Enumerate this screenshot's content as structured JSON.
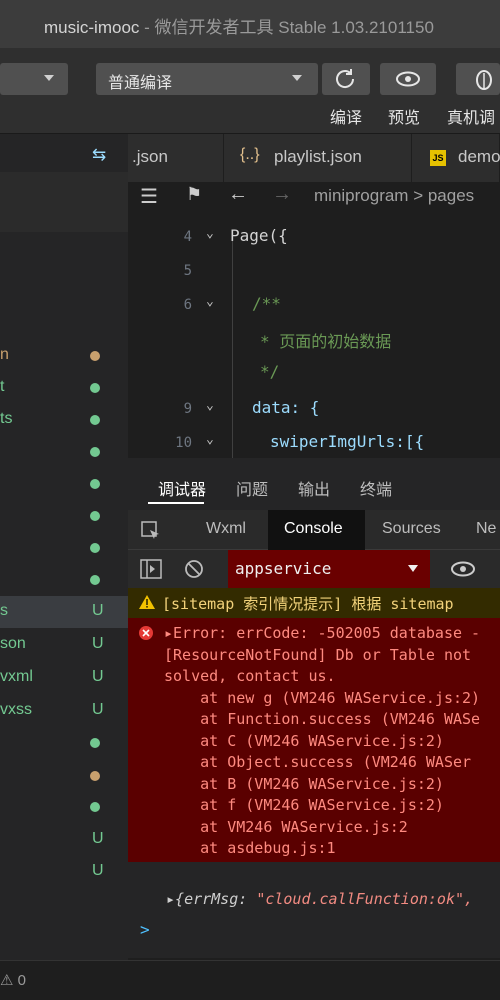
{
  "window": {
    "title_main": "music-imooc",
    "title_sub": " - 微信开发者工具 Stable 1.03.2101150"
  },
  "toolbar": {
    "compile_mode": "普通编译",
    "compile_label": "编译",
    "preview_label": "预览",
    "realdebug_label": "真机调"
  },
  "editor_tabs": [
    {
      "label": ".json",
      "icon": "json-icon"
    },
    {
      "label": "playlist.json",
      "icon": "braces-icon"
    },
    {
      "label": "demo",
      "icon": "js-icon"
    }
  ],
  "breadcrumb": "miniprogram > pages",
  "explorer": {
    "header_label": "...",
    "items": [
      {
        "name": "n",
        "status": "dot",
        "color": "#c8a06e"
      },
      {
        "name": "t",
        "status": "dot",
        "color": "#73c991"
      },
      {
        "name": "ts",
        "status": "dot",
        "color": "#73c991"
      },
      {
        "name": "",
        "status": "dot",
        "color": "#73c991"
      },
      {
        "name": "",
        "status": "dot",
        "color": "#73c991"
      },
      {
        "name": "",
        "status": "dot",
        "color": "#73c991"
      },
      {
        "name": "",
        "status": "dot",
        "color": "#73c991"
      },
      {
        "name": "",
        "status": "dot",
        "color": "#73c991"
      },
      {
        "name": "s",
        "status": "U",
        "color": "#73c991"
      },
      {
        "name": "son",
        "status": "U",
        "color": "#73c991"
      },
      {
        "name": "vxml",
        "status": "U",
        "color": "#73c991"
      },
      {
        "name": "vxss",
        "status": "U",
        "color": "#73c991"
      },
      {
        "name": "",
        "status": "dot",
        "color": "#73c991"
      },
      {
        "name": "",
        "status": "dot",
        "color": "#c8a06e"
      },
      {
        "name": "",
        "status": "dot",
        "color": "#73c991"
      },
      {
        "name": "",
        "status": "U",
        "color": "#73c991"
      },
      {
        "name": "",
        "status": "U",
        "color": "#73c991"
      }
    ]
  },
  "code": {
    "lines": [
      {
        "num": "4",
        "text": "Page({",
        "fold": true
      },
      {
        "num": "5",
        "text": "",
        "fold": false
      },
      {
        "num": "6",
        "text": "/**",
        "fold": true
      },
      {
        "num": "",
        "text": "* 页面的初始数据",
        "fold": false
      },
      {
        "num": "",
        "text": "*/",
        "fold": false
      },
      {
        "num": "9",
        "text": "data: {",
        "fold": true
      },
      {
        "num": "10",
        "text": "swiperImgUrls:[{",
        "fold": true
      }
    ]
  },
  "debugger": {
    "tabs": [
      "调试器",
      "问题",
      "输出",
      "终端"
    ],
    "subtabs": [
      "Wxml",
      "Console",
      "Sources",
      "Ne"
    ],
    "context": "appservice",
    "warning": "[sitemap 索引情况提示] 根据 sitemap",
    "error_lines": [
      "▸Error: errCode: -502005 database -",
      "[ResourceNotFound] Db or Table not",
      "solved, contact us.",
      "    at new g (VM246 WAService.js:2)",
      "    at Function.success (VM246 WASe",
      "    at C (VM246 WAService.js:2)",
      "    at Object.success (VM246 WASer",
      "    at B (VM246 WAService.js:2)",
      "    at f (VM246 WAService.js:2)",
      "    at VM246 WAService.js:2",
      "    at asdebug.js:1"
    ],
    "log_key": "errMsg:",
    "log_value": "\"cloud.callFunction:ok\",",
    "prompt": ">"
  },
  "statusbar": {
    "text": "⚠ 0"
  }
}
